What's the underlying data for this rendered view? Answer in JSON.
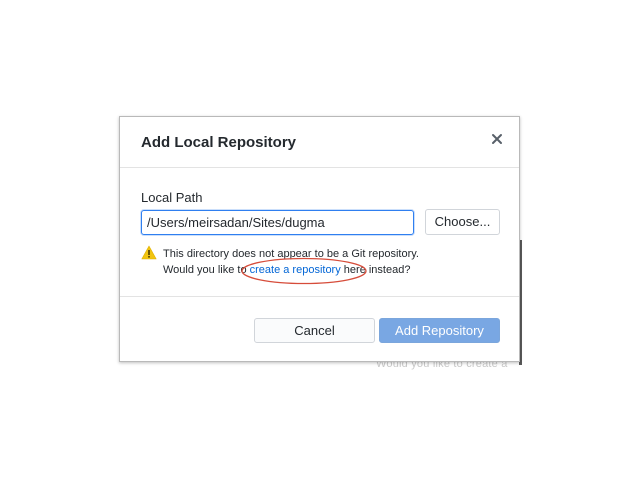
{
  "dialog": {
    "title": "Add Local Repository",
    "close_icon": "close-icon",
    "local_path": {
      "label": "Local Path",
      "value": "/Users/meirsadan/Sites/dugma",
      "choose_label": "Choose..."
    },
    "warning": {
      "icon": "warning-icon",
      "line1": "This directory does not appear to be a Git repository.",
      "line2_prefix": "Would you like to ",
      "link_text": "create a repository",
      "line2_suffix": " here instead?"
    },
    "footer": {
      "cancel_label": "Cancel",
      "add_label": "Add Repository",
      "add_enabled": false
    }
  },
  "background": {
    "ghost_text": "Would you like to create a"
  },
  "colors": {
    "accent": "#0366d6",
    "primary_button_disabled": "#79a7e3",
    "focus_border": "#2f7ff0",
    "warning": "#f1c40f",
    "annotation": "#d64c3a"
  }
}
